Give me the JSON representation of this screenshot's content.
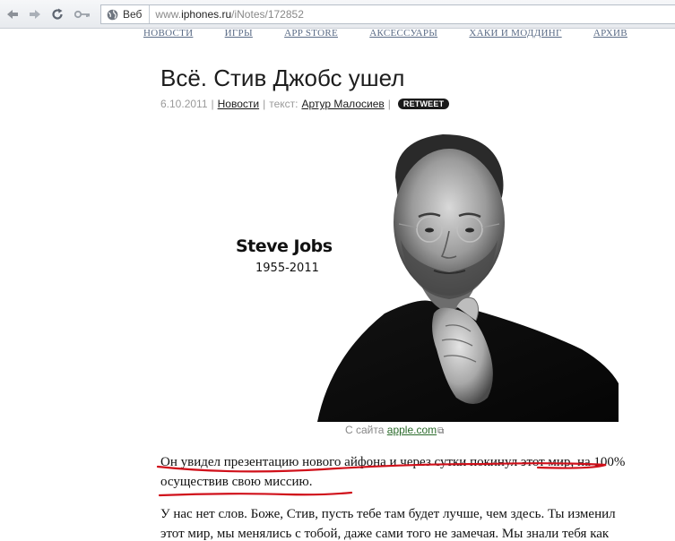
{
  "browser": {
    "address_label": "Веб",
    "url_prefix": "www.",
    "url_host": "iphones.ru",
    "url_path": "/iNotes/172852",
    "icons": [
      "back-arrow-icon",
      "forward-arrow-icon",
      "reload-icon",
      "key-icon",
      "globe-icon"
    ]
  },
  "site_nav": {
    "items": [
      "НОВОСТИ",
      "ИГРЫ",
      "APP STORE",
      "АКСЕССУАРЫ",
      "ХАКИ И МОДДИНГ",
      "АРХИВ"
    ]
  },
  "article": {
    "title": "Всё. Стив Джобс ушел",
    "date": "6.10.2011",
    "category": "Новости",
    "author_prefix": "текст:",
    "author": "Артур Малосиев",
    "retweet_label": "RETWEET",
    "photo_name": "Steve Jobs",
    "photo_years": "1955-2011",
    "credit_prefix": "С сайта",
    "credit_link": "apple.com",
    "lead": "Он увидел презентацию нового айфона и через сутки покинул этот мир, на 100% осуществив свою миссию.",
    "body": "У нас нет слов. Боже, Стив, пусть тебе там будет лучше, чем здесь. Ты изменил этот мир, мы менялись с тобой, даже сами того не замечая. Мы знали тебя как"
  },
  "colors": {
    "annotation_red": "#d0101a",
    "nav_link": "#5a6b86",
    "credit_link": "#2b6b2b"
  }
}
